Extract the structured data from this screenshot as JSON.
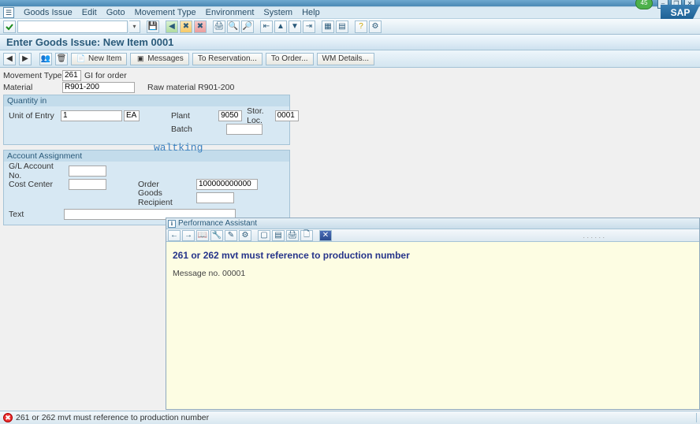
{
  "window": {
    "green_indicator": "45",
    "btn_min": "–",
    "btn_max": "❐",
    "btn_close": "✕"
  },
  "menu": {
    "goods_issue": "Goods Issue",
    "edit": "Edit",
    "goto": "Goto",
    "movement_type": "Movement Type",
    "environment": "Environment",
    "system": "System",
    "help": "Help"
  },
  "logo_text": "SAP",
  "std_toolbar": {
    "cmd_value": ""
  },
  "page_title": "Enter Goods Issue: New Item 0001",
  "app_toolbar": {
    "new_item": "New Item",
    "messages": "Messages",
    "to_reservation": "To Reservation...",
    "to_order": "To Order...",
    "wm_details": "WM Details..."
  },
  "header": {
    "movement_type_label": "Movement Type",
    "movement_type_value": "261",
    "movement_type_text": "GI for order",
    "material_label": "Material",
    "material_value": "R901-200",
    "material_text": "Raw material R901-200"
  },
  "quantity_box": {
    "title": "Quantity in",
    "unit_of_entry_label": "Unit of Entry",
    "unit_of_entry_qty": "1",
    "unit_of_entry_uom": "EA",
    "plant_label": "Plant",
    "plant_value": "9050",
    "stor_loc_label": "Stor. Loc.",
    "stor_loc_value": "0001",
    "batch_label": "Batch",
    "batch_value": ""
  },
  "account_box": {
    "title": "Account Assignment",
    "gl_account_label": "G/L Account No.",
    "gl_account_value": "",
    "cost_center_label": "Cost Center",
    "cost_center_value": "",
    "order_label": "Order",
    "order_value": "100000000000",
    "goods_recipient_label": "Goods Recipient",
    "goods_recipient_value": "",
    "text_label": "Text",
    "text_value": ""
  },
  "watermark_text": "waltking",
  "perf_assist": {
    "title": "Performance Assistant",
    "heading": "261 or 262 mvt must reference to production number",
    "message_no": "Message no. 00001"
  },
  "statusbar": {
    "message": "261 or 262 mvt must reference to production number"
  }
}
